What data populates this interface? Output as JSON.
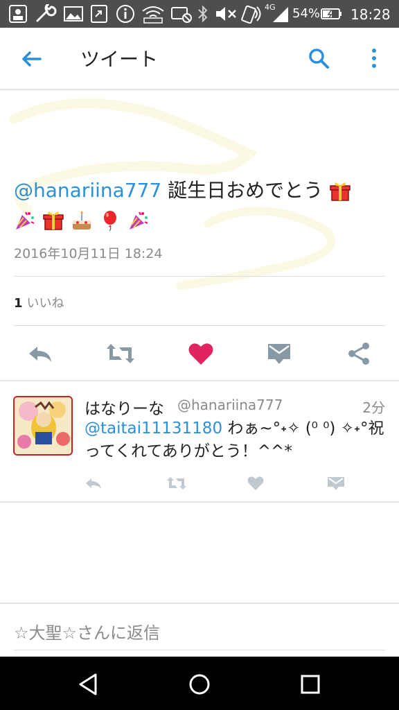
{
  "status_bar": {
    "battery_percent": "54%",
    "clock": "18:28",
    "network": "4G",
    "icons": [
      "sim-icon",
      "wrench-icon",
      "gallery-icon",
      "share-icon",
      "info-icon",
      "wifi-icon",
      "record-icon",
      "bluetooth-icon",
      "mute-icon",
      "nfc-icon",
      "signal-icon",
      "battery-icon"
    ]
  },
  "app_bar": {
    "title": "ツイート",
    "icons": [
      "back-arrow-icon",
      "search-icon",
      "more-vert-icon"
    ]
  },
  "tweet": {
    "mention": "@hanariina777",
    "text": " 誕生日おめでとう",
    "emojis_line1": [
      "gift-icon"
    ],
    "emojis_line2": [
      "party-popper-icon",
      "gift-icon",
      "cake-icon",
      "balloon-icon",
      "party-popper-icon"
    ],
    "timestamp": "2016年10月11日 18:24",
    "like_count": "1",
    "like_label": "いいね",
    "actions": [
      "reply-icon",
      "retweet-icon",
      "heart-icon",
      "message-icon",
      "share-icon"
    ],
    "liked": true,
    "colors": {
      "accent": "#2b90d9",
      "heart": "#e0245e",
      "icon_gray": "#8899a6"
    }
  },
  "reply": {
    "display_name": "はなりーな",
    "handle": "@hanariina777",
    "time": "2分",
    "mention": "@taitai11131180",
    "text": " わぁ~°˖✧ (⁰ ⁰) ✧˖°祝ってくれてありがとう！^^*",
    "actions": [
      "reply-icon",
      "retweet-icon",
      "heart-icon",
      "message-icon"
    ]
  },
  "composer": {
    "placeholder": "☆大聖☆さんに返信"
  },
  "nav_bar": {
    "buttons": [
      "back-triangle-icon",
      "home-circle-icon",
      "recents-square-icon"
    ]
  }
}
